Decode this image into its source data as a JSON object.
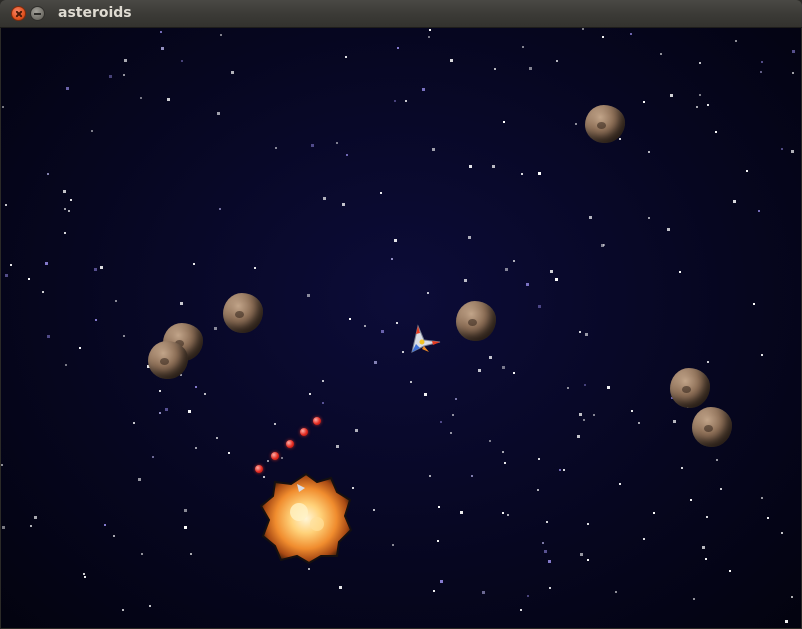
{
  "window": {
    "title": "asteroids"
  },
  "colors": {
    "space": "#06061f",
    "star": "#ffffff",
    "bullet": "#e32a20",
    "asteroid": "#8d6f57",
    "explosion": "#ffb347"
  },
  "icons": {
    "close": "close-icon",
    "minimize": "minimize-icon"
  },
  "sprites": {
    "player": "spaceship",
    "asteroid_count": 7,
    "bullet_count": 5,
    "explosion_count": 1
  }
}
